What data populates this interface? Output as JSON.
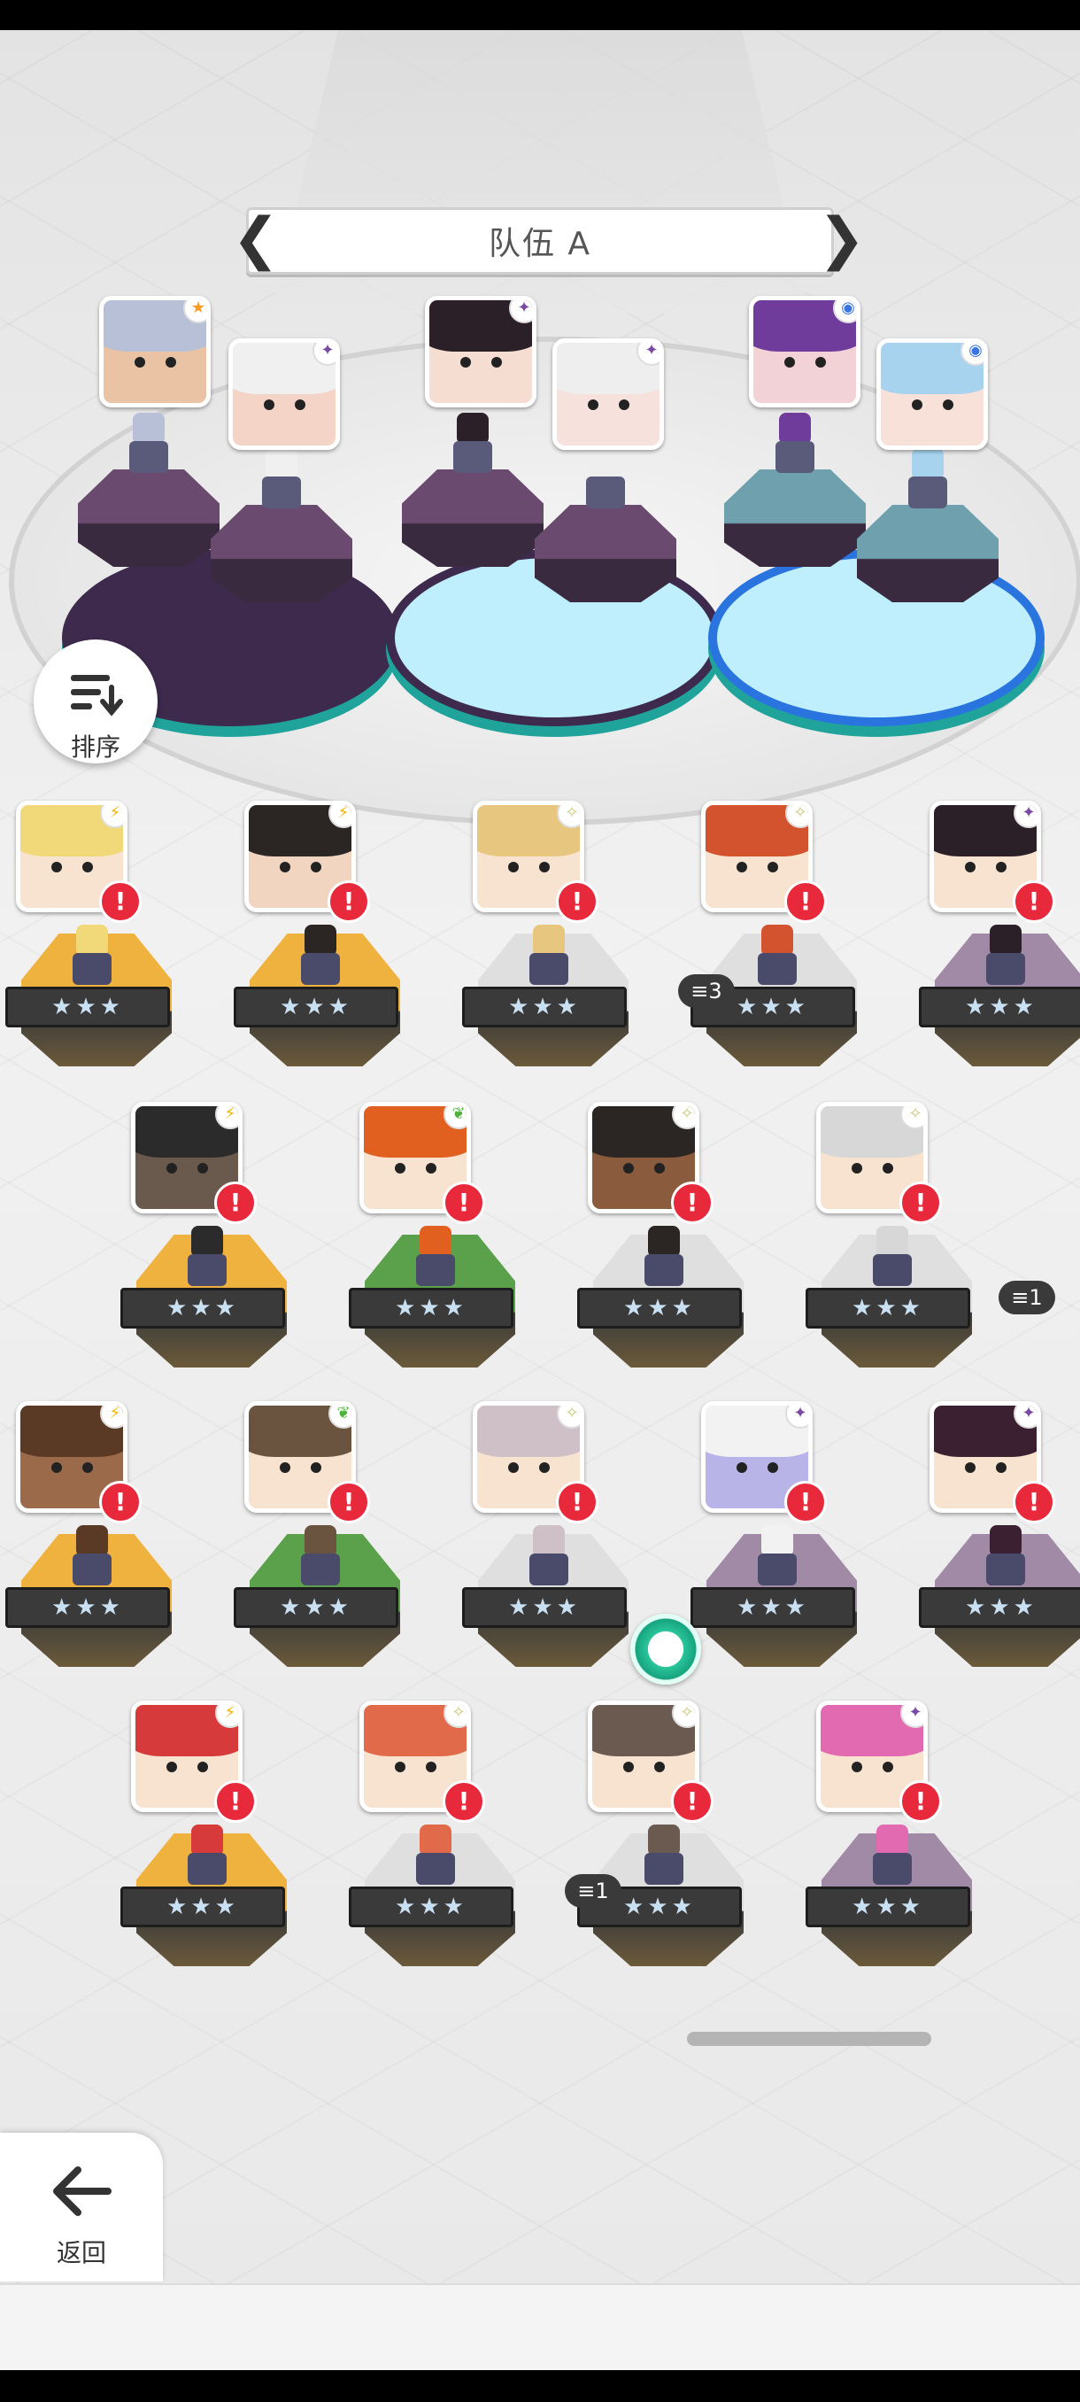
{
  "team": {
    "title": "队伍 A",
    "prev_arrow": "❮",
    "next_arrow": "❯"
  },
  "sort_button": {
    "label": "排序"
  },
  "back_button": {
    "label": "返回"
  },
  "team_members": [
    {
      "name": "member-1",
      "hair": "#b8c0d8",
      "face": "#e9c3a3",
      "elem": "★",
      "elem_color": "#ff9a1f",
      "ring": "#3d2a4d"
    },
    {
      "name": "member-2",
      "hair": "#f0f0f0",
      "face": "#f5d4c8",
      "elem": "✦",
      "elem_color": "#7b4aa3",
      "ring": "#3d2a4d"
    },
    {
      "name": "member-3",
      "hair": "#2b2028",
      "face": "#f6ddd2",
      "elem": "✦",
      "elem_color": "#7b4aa3",
      "ring": "#4a8ad0"
    },
    {
      "name": "member-4",
      "hair": "#eeeeee",
      "face": "#f6e1dc",
      "elem": "✦",
      "elem_color": "#7b4aa3",
      "ring": "#4a8ad0"
    },
    {
      "name": "member-5",
      "hair": "#6f3c9b",
      "face": "#f2d2d6",
      "elem": "◉",
      "elem_color": "#3a74e0",
      "ring": "#2a74e0"
    },
    {
      "name": "member-6",
      "hair": "#a8d3ee",
      "face": "#f7e1d8",
      "elem": "◉",
      "elem_color": "#3a74e0",
      "ring": "#2a74e0"
    }
  ],
  "roster": [
    {
      "row": 0,
      "col": 0,
      "hair": "#f1d879",
      "face": "#f7e3cf",
      "elem": "⚡",
      "elem_color": "#f2b400",
      "pedestal": "#f0b23e",
      "stars": "★★★"
    },
    {
      "row": 0,
      "col": 1,
      "hair": "#2b2624",
      "face": "#f2d5c0",
      "elem": "⚡",
      "elem_color": "#f2b400",
      "pedestal": "#f0b23e",
      "stars": "★★★"
    },
    {
      "row": 0,
      "col": 2,
      "hair": "#e7c77f",
      "face": "#f7e3cf",
      "elem": "✧",
      "elem_color": "#c8c87a",
      "pedestal": "#dfdfdf",
      "stars": "★★★"
    },
    {
      "row": 0,
      "col": 3,
      "hair": "#d4532f",
      "face": "#f7e3cf",
      "elem": "✧",
      "elem_color": "#c8c87a",
      "pedestal": "#dfdfdf",
      "stars": "★★★",
      "stack": "3"
    },
    {
      "row": 0,
      "col": 4,
      "hair": "#2b2028",
      "face": "#f7e3cf",
      "elem": "✦",
      "elem_color": "#7b4aa3",
      "pedestal": "#a08aa6",
      "stars": "★★★"
    },
    {
      "row": 1,
      "col": 0,
      "hair": "#2b2b2b",
      "face": "#6a5a4e",
      "elem": "⚡",
      "elem_color": "#f2b400",
      "pedestal": "#f0b23e",
      "stars": "★★★"
    },
    {
      "row": 1,
      "col": 1,
      "hair": "#e2601f",
      "face": "#f7e3cf",
      "elem": "❦",
      "elem_color": "#4fb23e",
      "pedestal": "#5ba04a",
      "stars": "★★★"
    },
    {
      "row": 1,
      "col": 2,
      "hair": "#2b2624",
      "face": "#8a5b3c",
      "elem": "✧",
      "elem_color": "#c8c87a",
      "pedestal": "#dfdfdf",
      "stars": "★★★"
    },
    {
      "row": 1,
      "col": 3,
      "hair": "#d7d7d7",
      "face": "#f7e3cf",
      "elem": "✧",
      "elem_color": "#c8c87a",
      "pedestal": "#dfdfdf",
      "stars": "★★★"
    },
    {
      "row": 2,
      "col": 0,
      "hair": "#5a3a24",
      "face": "#9a6a4a",
      "elem": "⚡",
      "elem_color": "#f2b400",
      "pedestal": "#f0b23e",
      "stars": "★★★"
    },
    {
      "row": 2,
      "col": 1,
      "hair": "#6a5440",
      "face": "#f7e3cf",
      "elem": "❦",
      "elem_color": "#4fb23e",
      "pedestal": "#5ba04a",
      "stars": "★★★"
    },
    {
      "row": 2,
      "col": 2,
      "hair": "#cfc0c8",
      "face": "#f7e3cf",
      "elem": "✧",
      "elem_color": "#c8c87a",
      "pedestal": "#dfdfdf",
      "stars": "★★★"
    },
    {
      "row": 2,
      "col": 3,
      "hair": "#f2f2f2",
      "face": "#b8b4e8",
      "elem": "✦",
      "elem_color": "#7b4aa3",
      "pedestal": "#a08aa6",
      "stars": "★★★"
    },
    {
      "row": 2,
      "col": 4,
      "hair": "#3a2030",
      "face": "#f7e3cf",
      "elem": "✦",
      "elem_color": "#7b4aa3",
      "pedestal": "#a08aa6",
      "stars": "★★★"
    },
    {
      "row": 3,
      "col": 0,
      "hair": "#d63a3a",
      "face": "#f7e3cf",
      "elem": "⚡",
      "elem_color": "#f2b400",
      "pedestal": "#f0b23e",
      "stars": "★★★"
    },
    {
      "row": 3,
      "col": 1,
      "hair": "#e06a4a",
      "face": "#f7e3cf",
      "elem": "✧",
      "elem_color": "#c8c87a",
      "pedestal": "#dfdfdf",
      "stars": "★★★"
    },
    {
      "row": 3,
      "col": 2,
      "hair": "#6a5a50",
      "face": "#f7e3cf",
      "elem": "✧",
      "elem_color": "#c8c87a",
      "pedestal": "#dfdfdf",
      "stars": "★★★",
      "stack": "1"
    },
    {
      "row": 3,
      "col": 3,
      "hair": "#e26ab0",
      "face": "#f7e3cf",
      "elem": "✦",
      "elem_color": "#7b4aa3",
      "pedestal": "#a08aa6",
      "stars": "★★★"
    }
  ],
  "edge_stack_label": "1",
  "alert_glyph": "!",
  "stack_icon": "≡"
}
